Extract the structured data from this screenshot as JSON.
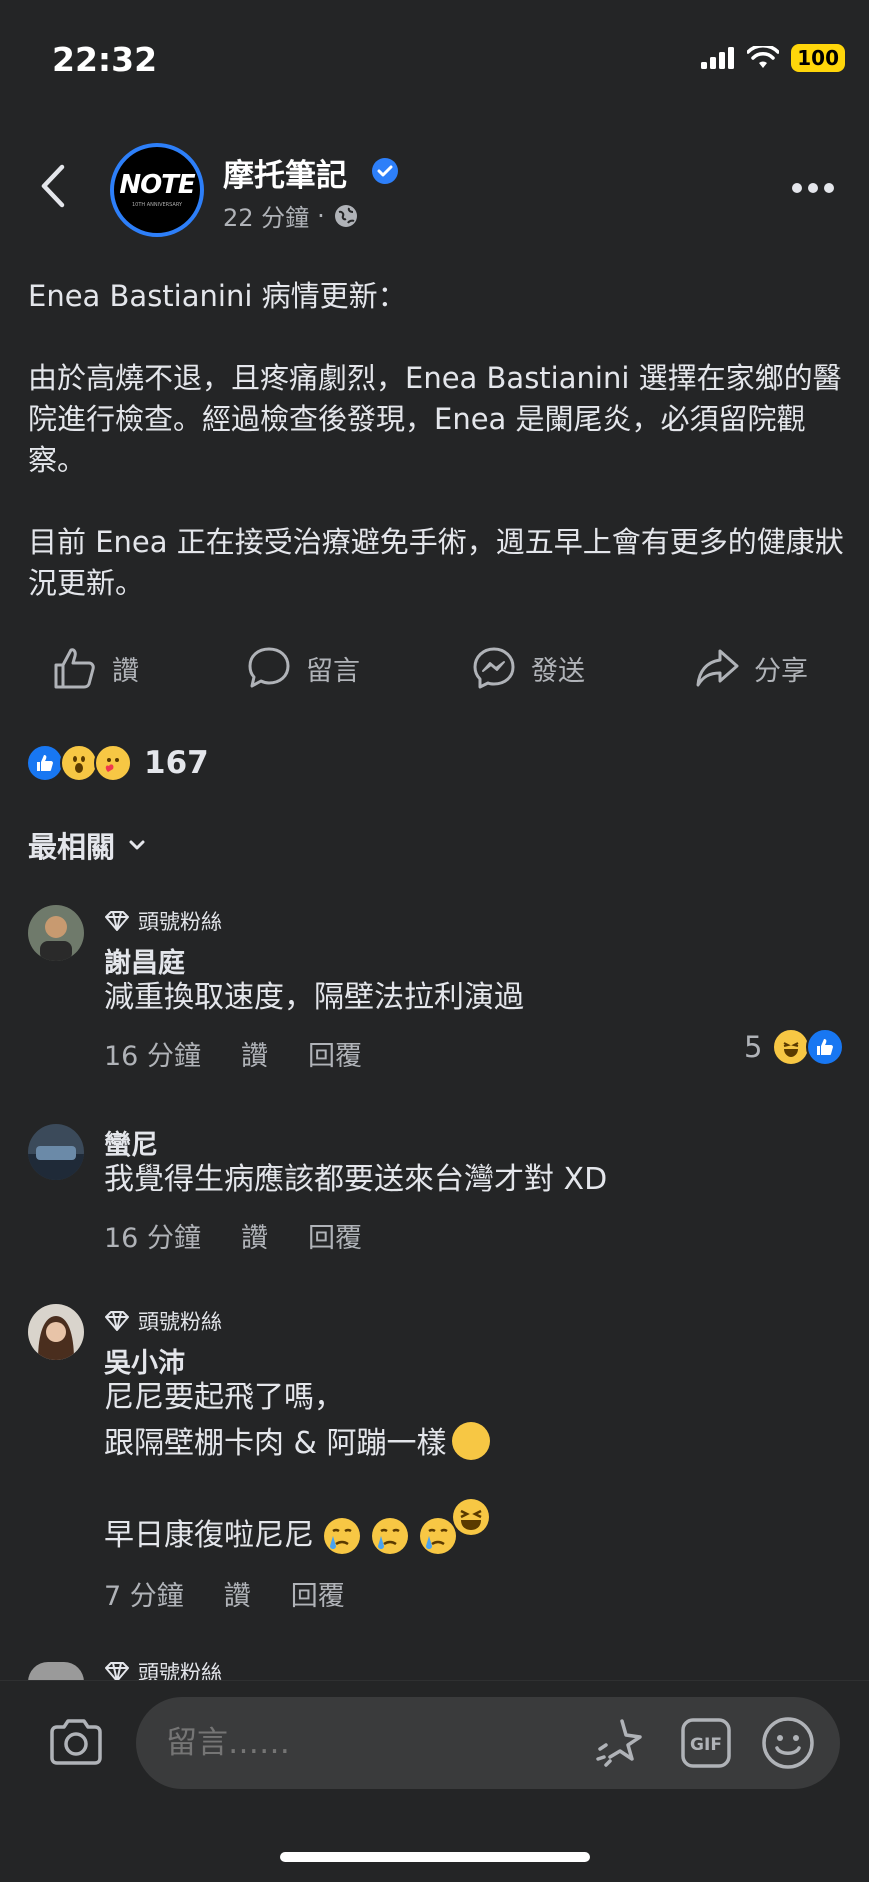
{
  "status_bar": {
    "time": "22:32",
    "battery": "100"
  },
  "header": {
    "page_name": "摩托筆記",
    "avatar_logo": "NOTE",
    "avatar_sub": "10TH ANNIVERSARY",
    "time_ago": "22 分鐘",
    "separator": "·",
    "audience_icon": "globe-icon"
  },
  "post": {
    "body": "Enea Bastianini 病情更新：\n\n由於高燒不退，且疼痛劇烈，Enea Bastianini 選擇在家鄉的醫院進行檢查。經過檢查後發現，Enea 是闌尾炎，必須留院觀察。\n\n目前 Enea 正在接受治療避免手術，週五早上會有更多的健康狀況更新。"
  },
  "actions": {
    "like": "讚",
    "comment": "留言",
    "send": "發送",
    "share": "分享"
  },
  "reactions": {
    "count": "167",
    "types": [
      "like",
      "wow",
      "care"
    ]
  },
  "sort": {
    "label": "最相關"
  },
  "comments": [
    {
      "badge": "頭號粉絲",
      "name": "謝昌庭",
      "text": "減重換取速度，隔壁法拉利演過",
      "time": "16 分鐘",
      "like": "讚",
      "reply": "回覆",
      "reaction_count": "5"
    },
    {
      "name": "蠻尼",
      "text": "我覺得生病應該都要送來台灣才對 XD",
      "time": "16 分鐘",
      "like": "讚",
      "reply": "回覆"
    },
    {
      "badge": "頭號粉絲",
      "name": "吳小沛",
      "line1": "尼尼要起飛了嗎，",
      "line2": "跟隔壁棚卡肉 & 阿蹦一樣",
      "line3": "早日康復啦尼尼",
      "time": "7 分鐘",
      "like": "讚",
      "reply": "回覆"
    },
    {
      "badge": "頭號粉絲"
    }
  ],
  "composer": {
    "placeholder": "留言……",
    "gif": "GIF"
  },
  "colors": {
    "background": "#242526",
    "accent": "#2d7ff9",
    "text": "#e4e6eb",
    "muted": "#b0b3b8"
  }
}
